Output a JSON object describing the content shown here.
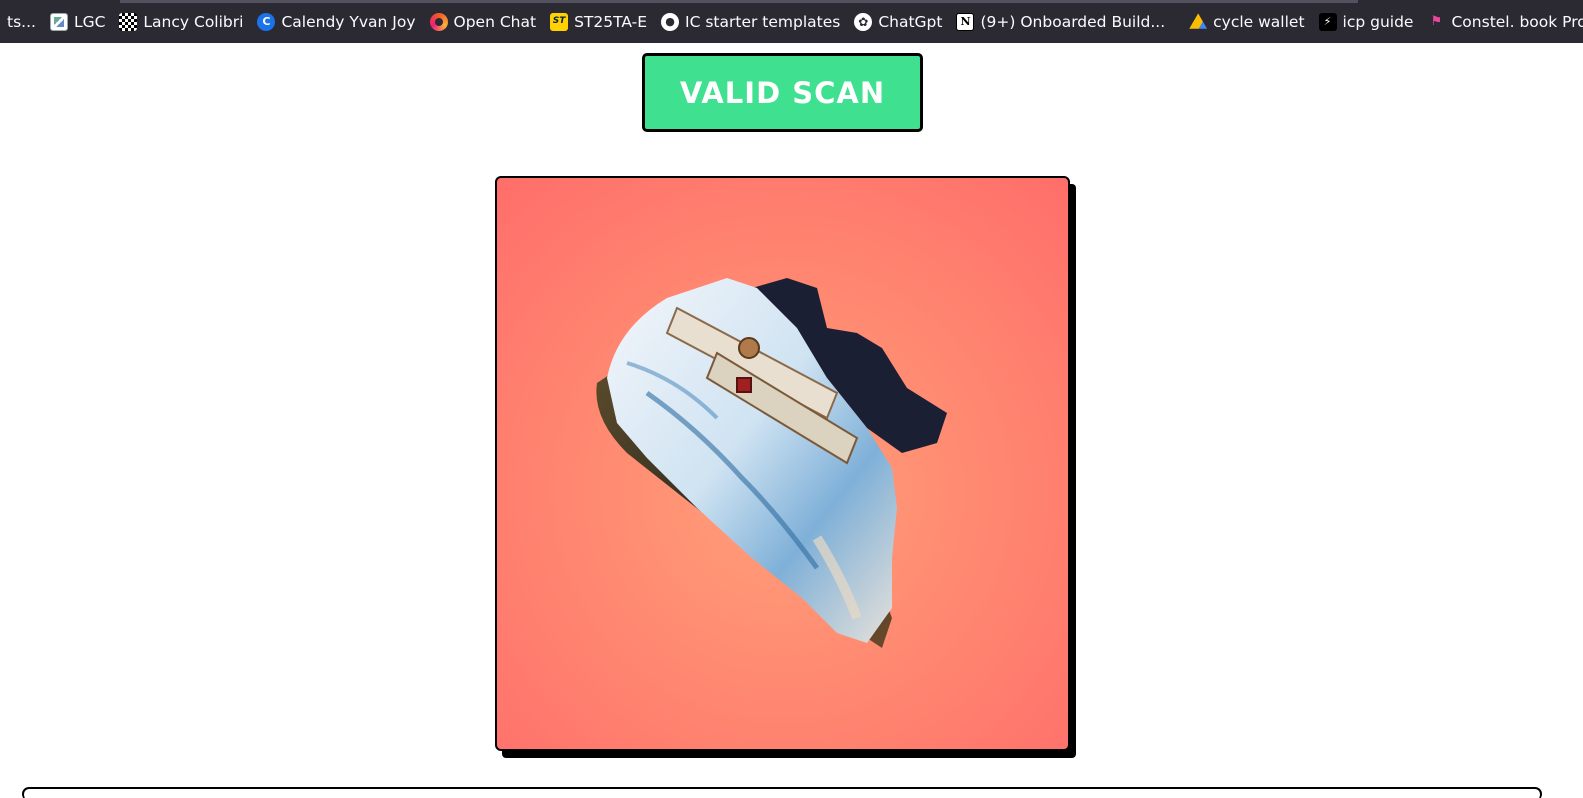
{
  "bookmarks": {
    "items": [
      {
        "label": "ts...",
        "icon": "none"
      },
      {
        "label": "LGC",
        "icon": "lgc-icon"
      },
      {
        "label": "Lancy Colibri",
        "icon": "checker-icon"
      },
      {
        "label": "Calendy Yvan Joy",
        "icon": "calendy-icon",
        "glyph": "C"
      },
      {
        "label": "Open Chat",
        "icon": "openchat-icon"
      },
      {
        "label": "ST25TA-E",
        "icon": "st-icon",
        "glyph": "ST"
      },
      {
        "label": "IC starter templates",
        "icon": "github-icon",
        "glyph": "●"
      },
      {
        "label": "ChatGpt",
        "icon": "chatgpt-icon",
        "glyph": "✿"
      },
      {
        "label": "(9+) Onboarded Build...",
        "icon": "notion-icon",
        "glyph": "N"
      },
      {
        "label": "cycle wallet",
        "icon": "google-drive-icon"
      },
      {
        "label": "icp guide",
        "icon": "bolt-icon",
        "glyph": "⚡"
      },
      {
        "label": "Constel. book Proton",
        "icon": "constel-icon",
        "glyph": "⚑"
      }
    ],
    "overflow_glyph": "€"
  },
  "main": {
    "scan_button_label": "VALID SCAN",
    "colors": {
      "button_bg": "#3fe08f",
      "card_bg_center": "#ffa07a",
      "card_bg_edge": "#ff6e6a"
    },
    "image": {
      "subject": "sneaker-image"
    }
  }
}
